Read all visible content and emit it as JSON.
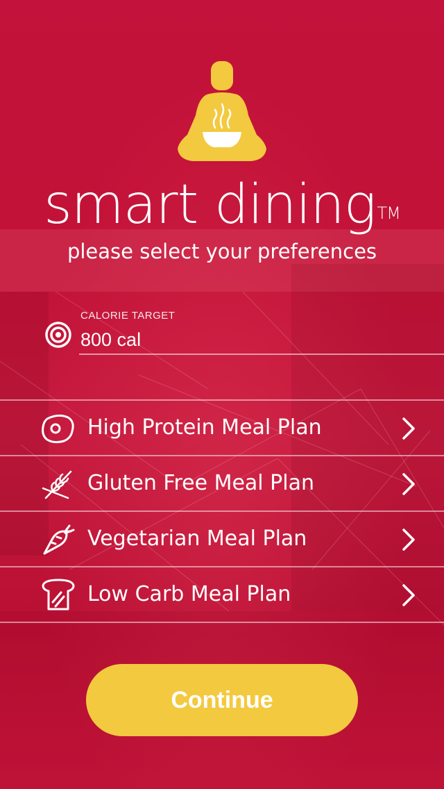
{
  "brand": {
    "name": "smart dining",
    "trademark": "TM",
    "logo_icon": "meditating-person-with-bowl-icon",
    "logo_color": "#f3c93f"
  },
  "subtitle": "please select your preferences",
  "calorie_target": {
    "label": "CALORIE TARGET",
    "value": "800 cal",
    "icon": "target-icon"
  },
  "meal_plans": [
    {
      "label": "High Protein Meal Plan",
      "icon": "steak-icon"
    },
    {
      "label": "Gluten Free Meal Plan",
      "icon": "wheat-crossed-icon"
    },
    {
      "label": "Vegetarian Meal Plan",
      "icon": "carrot-icon"
    },
    {
      "label": "Low Carb Meal Plan",
      "icon": "bread-crossed-icon"
    }
  ],
  "continue_button": {
    "label": "Continue",
    "color": "#f3c93f"
  },
  "colors": {
    "background": "#c3123b",
    "text": "#ffffff"
  }
}
